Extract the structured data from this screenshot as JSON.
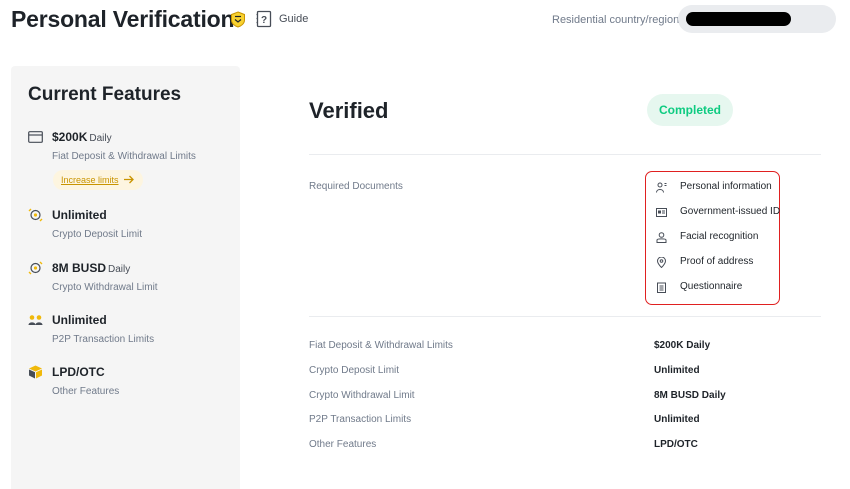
{
  "header": {
    "title": "Personal Verification",
    "guide_label": "Guide",
    "country_label": "Residential country/region:",
    "country_value": ""
  },
  "sidebar": {
    "title": "Current Features",
    "features": [
      {
        "icon": "card-icon",
        "main": "$200K",
        "unit": "Daily",
        "sub": "Fiat Deposit & Withdrawal Limits"
      },
      {
        "icon": "crypto-deposit-icon",
        "main": "Unlimited",
        "unit": "",
        "sub": "Crypto Deposit Limit"
      },
      {
        "icon": "crypto-withdrawal-icon",
        "main": "8M BUSD",
        "unit": "Daily",
        "sub": "Crypto Withdrawal Limit"
      },
      {
        "icon": "p2p-icon",
        "main": "Unlimited",
        "unit": "",
        "sub": "P2P Transaction Limits"
      },
      {
        "icon": "cube-icon",
        "main": "LPD/OTC",
        "unit": "",
        "sub": "Other Features"
      }
    ],
    "increase_label": "Increase limits"
  },
  "main": {
    "title": "Verified",
    "status": "Completed",
    "required_label": "Required Documents",
    "documents": [
      {
        "icon": "person-info-icon",
        "label": "Personal information"
      },
      {
        "icon": "id-card-icon",
        "label": "Government-issued ID"
      },
      {
        "icon": "face-icon",
        "label": "Facial recognition"
      },
      {
        "icon": "location-pin-icon",
        "label": "Proof of address"
      },
      {
        "icon": "clipboard-icon",
        "label": "Questionnaire"
      }
    ],
    "limits": [
      {
        "label": "Fiat Deposit & Withdrawal Limits",
        "value": "$200K Daily"
      },
      {
        "label": "Crypto Deposit Limit",
        "value": "Unlimited"
      },
      {
        "label": "Crypto Withdrawal Limit",
        "value": "8M BUSD Daily"
      },
      {
        "label": "P2P Transaction Limits",
        "value": "Unlimited"
      },
      {
        "label": "Other Features",
        "value": "LPD/OTC"
      }
    ]
  },
  "colors": {
    "accent": "#f0b90b",
    "success": "#0ecb81",
    "highlight_border": "#e02020"
  }
}
